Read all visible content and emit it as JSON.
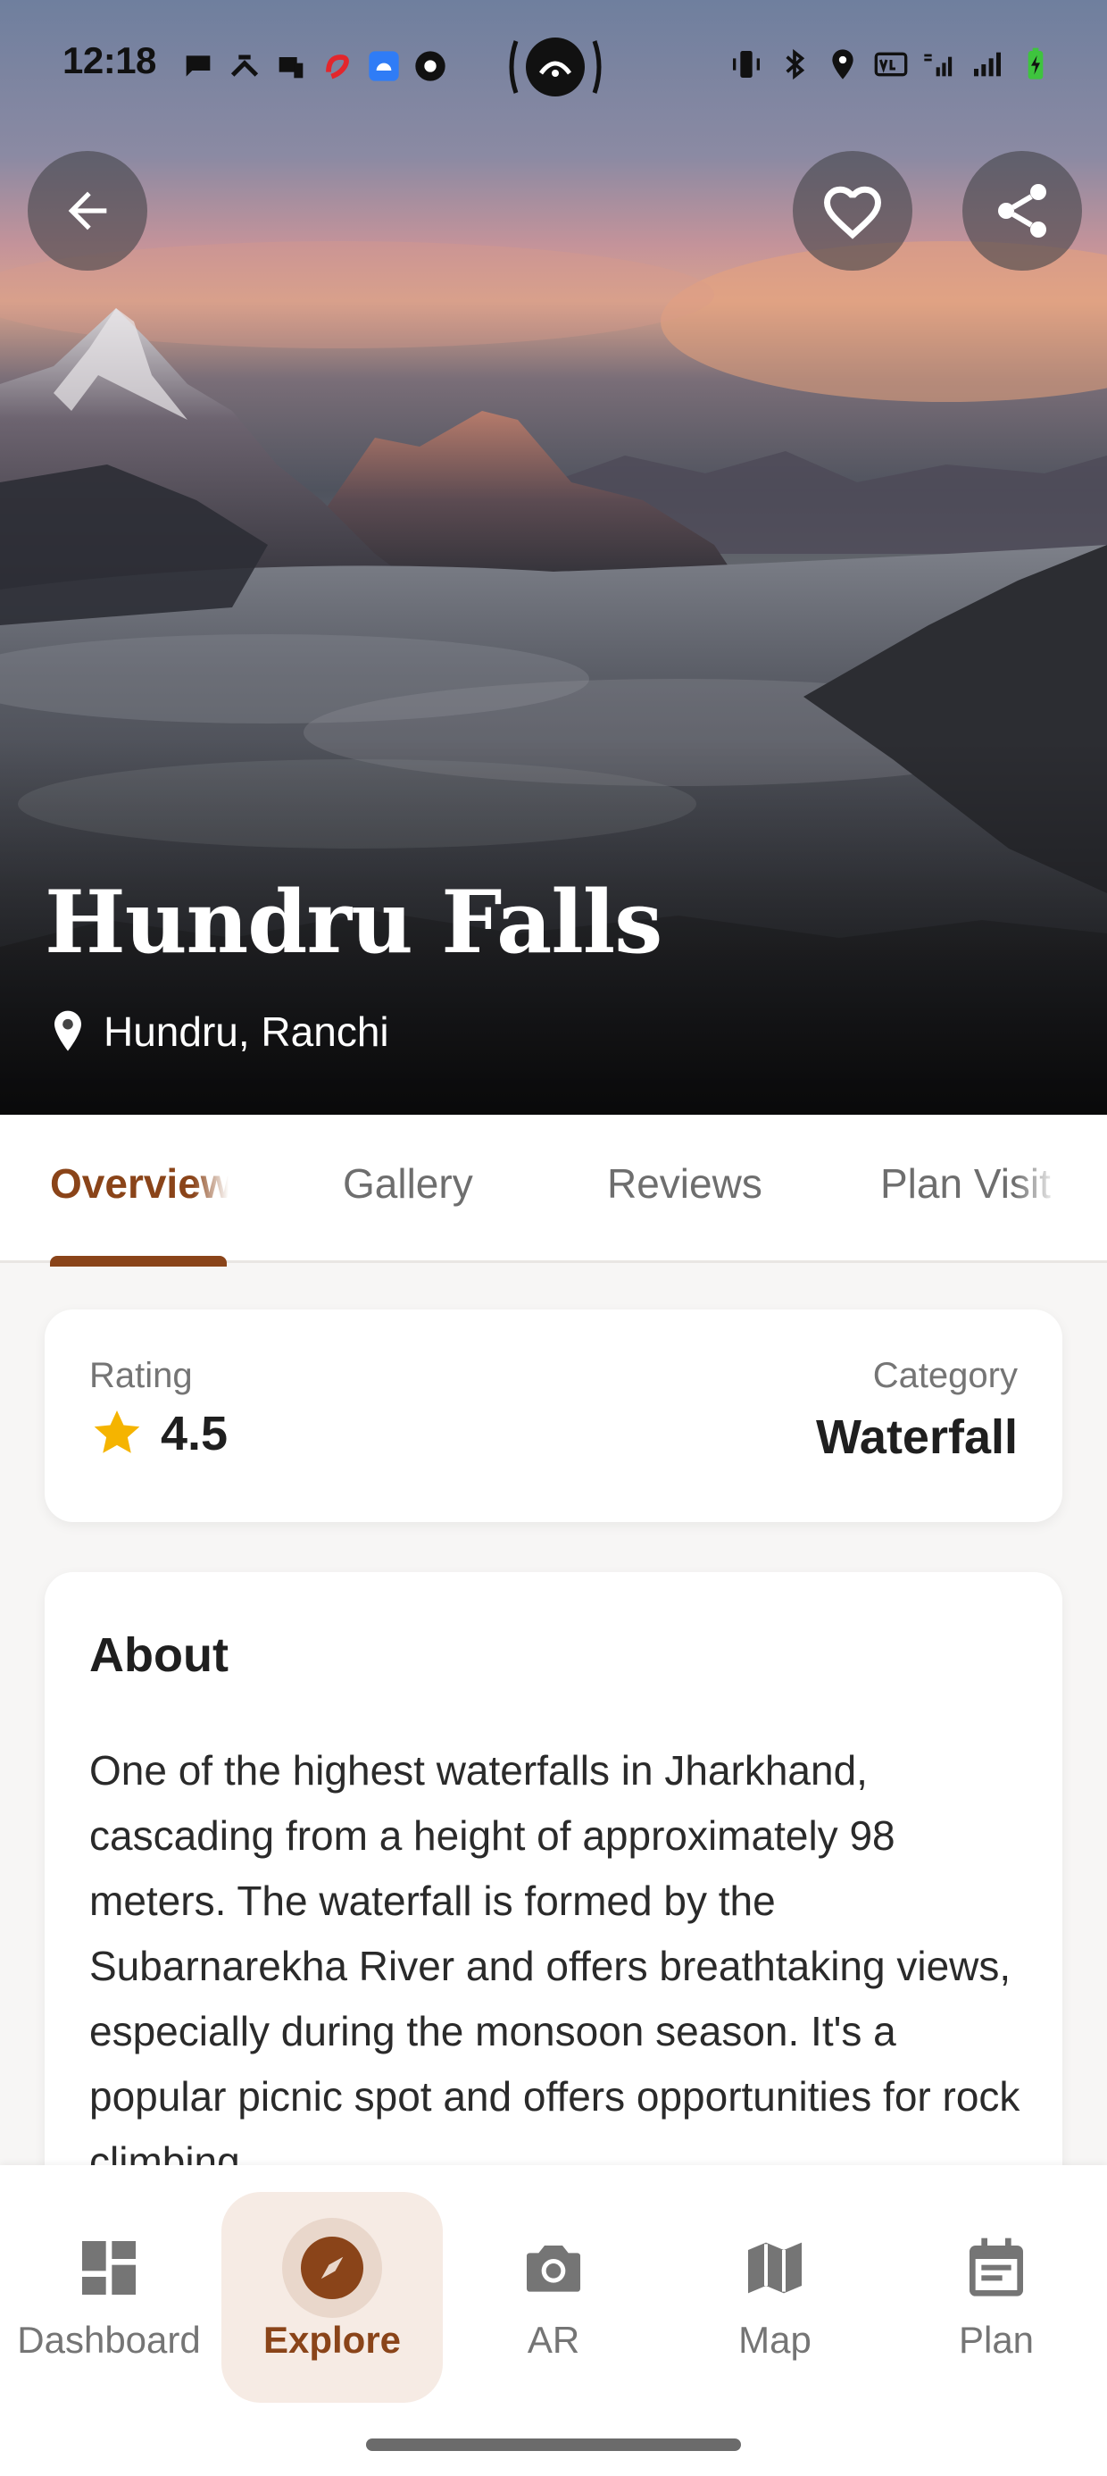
{
  "status_bar": {
    "time": "12:18"
  },
  "place": {
    "name": "Hundru Falls",
    "location": "Hundru, Ranchi"
  },
  "tabs": [
    {
      "label": "Overview",
      "active": true
    },
    {
      "label": "Gallery",
      "active": false
    },
    {
      "label": "Reviews",
      "active": false
    },
    {
      "label": "Plan Visit",
      "active": false
    }
  ],
  "summary": {
    "rating_label": "Rating",
    "rating_value": "4.5",
    "category_label": "Category",
    "category_value": "Waterfall"
  },
  "about": {
    "title": "About",
    "text": "One of the highest waterfalls in Jharkhand, cascading from a height of approximately 98 meters. The waterfall is formed by the Subarnarekha River and offers breathtaking views, especially during the monsoon season. It's a popular picnic spot and offers opportunities for rock climbing."
  },
  "bottom_nav": [
    {
      "label": "Dashboard",
      "icon": "dashboard-icon",
      "active": false
    },
    {
      "label": "Explore",
      "icon": "compass-icon",
      "active": true
    },
    {
      "label": "AR",
      "icon": "camera-icon",
      "active": false
    },
    {
      "label": "Map",
      "icon": "map-icon",
      "active": false
    },
    {
      "label": "Plan",
      "icon": "calendar-icon",
      "active": false
    }
  ],
  "colors": {
    "accent": "#8a4419",
    "accent_soft": "#f6ebe4",
    "star": "#f5b400"
  }
}
